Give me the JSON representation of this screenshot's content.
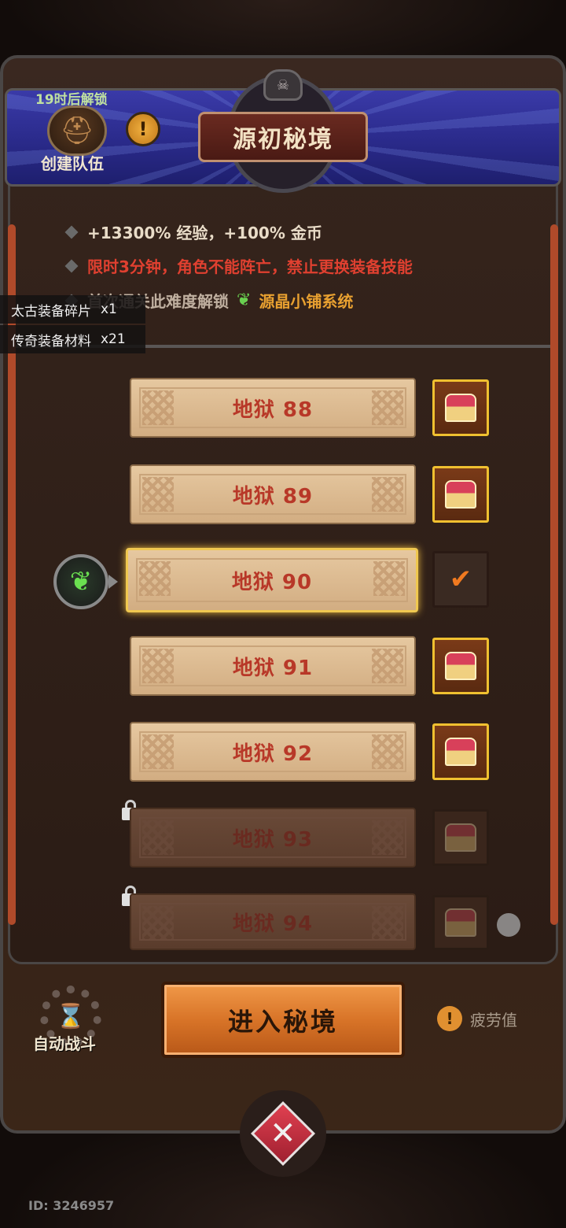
{
  "header": {
    "title": "源初秘境",
    "team_timer": "19时后解锁",
    "team_label": "创建队伍",
    "info_icon": "!"
  },
  "info": {
    "line1": "+13300% 经验，+100% 金币",
    "line2": "限时3分钟，角色不能阵亡，禁止更换装备技能",
    "line3_prefix": "首次通关此难度解锁",
    "line3_highlight": "源晶小铺系统"
  },
  "loot": [
    {
      "name": "太古装备碎片",
      "count": "x1"
    },
    {
      "name": "传奇装备材料",
      "count": "x21"
    }
  ],
  "levels": [
    {
      "label": "地狱 88",
      "chest": "available",
      "locked": false,
      "selected": false
    },
    {
      "label": "地狱 89",
      "chest": "available",
      "locked": false,
      "selected": false
    },
    {
      "label": "地狱 90",
      "chest": "claimed",
      "locked": false,
      "selected": true
    },
    {
      "label": "地狱 91",
      "chest": "available",
      "locked": false,
      "selected": false
    },
    {
      "label": "地狱 92",
      "chest": "available",
      "locked": false,
      "selected": false
    },
    {
      "label": "地狱 93",
      "chest": "locked",
      "locked": true,
      "selected": false
    },
    {
      "label": "地狱 94",
      "chest": "locked",
      "locked": true,
      "selected": false
    }
  ],
  "bottom": {
    "auto_battle_label": "自动战斗",
    "enter_label": "进入秘境",
    "fatigue_label": "疲劳值",
    "fatigue_icon": "!"
  },
  "user_id": "ID: 3246957",
  "icons": {
    "team": "helmet-icon",
    "marker": "crystal-leaf-icon",
    "chest": "treasure-chest-icon",
    "check": "✔",
    "close": "✕"
  },
  "colors": {
    "accent_red": "#b83828",
    "gold_border": "#f0c030",
    "enter_button": "#d87428"
  }
}
